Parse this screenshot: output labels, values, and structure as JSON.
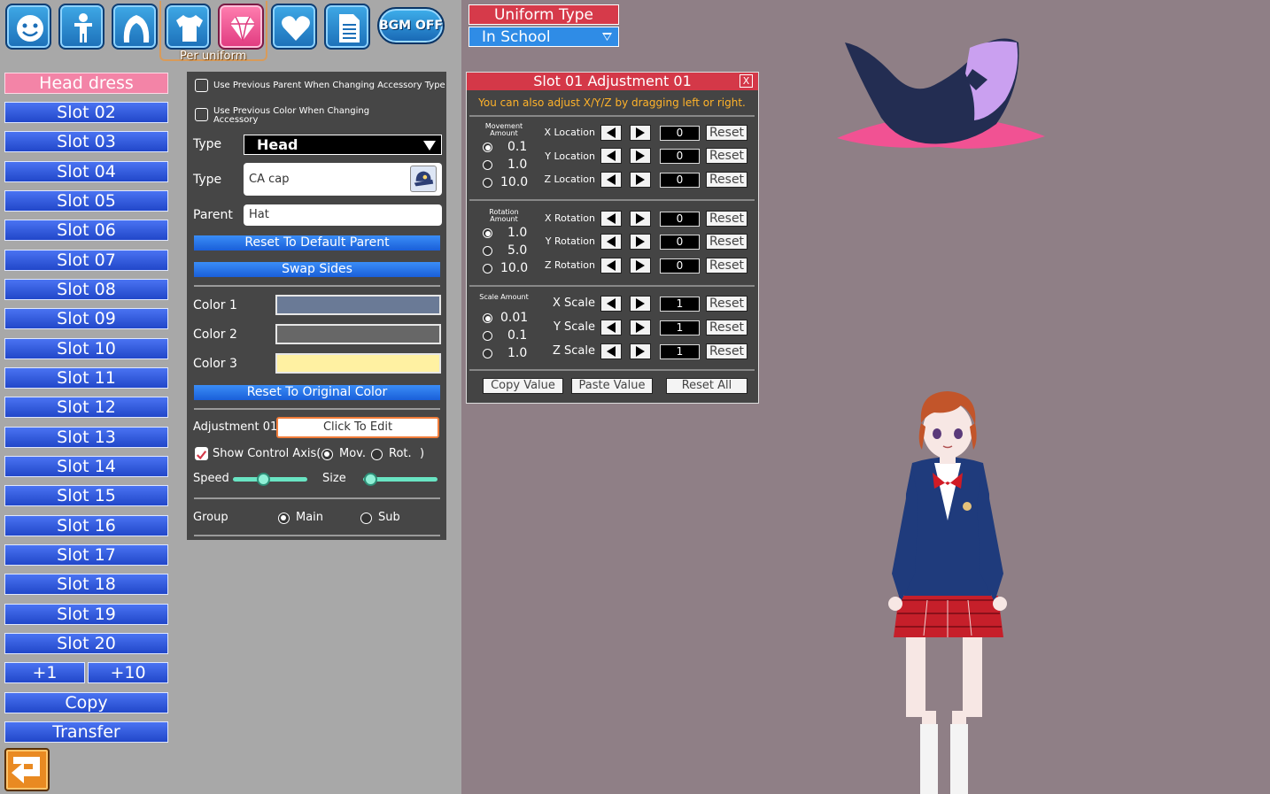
{
  "top_toolbar": {
    "per_uniform_label": "Per uniform",
    "bgm_label": "BGM OFF",
    "icons": [
      "face-icon",
      "body-icon",
      "hair-icon",
      "clothes-icon",
      "accessory-icon",
      "heart-icon",
      "document-icon"
    ]
  },
  "uniform_type": {
    "title": "Uniform Type",
    "selected": "In School"
  },
  "slots": [
    "Head dress",
    "Slot 02",
    "Slot 03",
    "Slot 04",
    "Slot 05",
    "Slot 06",
    "Slot 07",
    "Slot 08",
    "Slot 09",
    "Slot 10",
    "Slot 11",
    "Slot 12",
    "Slot 13",
    "Slot 14",
    "Slot 15",
    "Slot 16",
    "Slot 17",
    "Slot 18",
    "Slot 19",
    "Slot 20"
  ],
  "slot_actions": {
    "plus1": "+1",
    "plus10": "+10",
    "copy": "Copy",
    "transfer": "Transfer"
  },
  "accessory_panel": {
    "use_prev_parent": "Use Previous Parent When Changing Accessory Type",
    "use_prev_color": "Use Previous Color When Changing Accessory",
    "type_label": "Type",
    "type_value": "Head",
    "item_label": "Type",
    "item_value": "CA cap",
    "parent_label": "Parent",
    "parent_value": "Hat",
    "reset_parent": "Reset To Default Parent",
    "swap_sides": "Swap Sides",
    "color1_label": "Color 1",
    "color2_label": "Color 2",
    "color3_label": "Color 3",
    "color1": "#6a7a96",
    "color2": "#676767",
    "color3": "#fff1a2",
    "reset_color": "Reset To Original Color",
    "adjustment_label": "Adjustment 01",
    "adjustment_button": "Click To Edit",
    "show_axis": "Show Control Axis(",
    "mov": "Mov.",
    "rot": "Rot.",
    "close_paren": ")",
    "speed_label": "Speed",
    "size_label": "Size",
    "speed_level": 0.4,
    "size_level": 0.1,
    "group_label": "Group",
    "group_main": "Main",
    "group_sub": "Sub",
    "group_selected": "Main"
  },
  "adjustment_window": {
    "title": "Slot 01 Adjustment 01",
    "close": "X",
    "hint": "You can also adjust X/Y/Z by dragging left or right.",
    "movement": {
      "head": "Movement Amount",
      "amounts": [
        "0.1",
        "1.0",
        "10.0"
      ],
      "selected": "0.1",
      "axes": [
        {
          "label": "X Location",
          "value": "0"
        },
        {
          "label": "Y Location",
          "value": "0"
        },
        {
          "label": "Z Location",
          "value": "0"
        }
      ]
    },
    "rotation": {
      "head": "Rotation Amount",
      "amounts": [
        "1.0",
        "5.0",
        "10.0"
      ],
      "selected": "1.0",
      "axes": [
        {
          "label": "X Rotation",
          "value": "0"
        },
        {
          "label": "Y Rotation",
          "value": "0"
        },
        {
          "label": "Z Rotation",
          "value": "0"
        }
      ]
    },
    "scale": {
      "head": "Scale Amount",
      "amounts": [
        "0.01",
        "0.1",
        "1.0"
      ],
      "selected": "0.01",
      "axes": [
        {
          "label": "X Scale",
          "value": "1"
        },
        {
          "label": "Y Scale",
          "value": "1"
        },
        {
          "label": "Z Scale",
          "value": "1"
        }
      ]
    },
    "reset_label": "Reset",
    "copy_value": "Copy Value",
    "paste_value": "Paste Value",
    "reset_all": "Reset All"
  },
  "colors": {
    "slot_blue": "#2f58dc",
    "slot_active": "#f384a7",
    "title_red": "#d43848",
    "hint_orange": "#ffb32a",
    "stage_bg": "#8f7f86"
  }
}
